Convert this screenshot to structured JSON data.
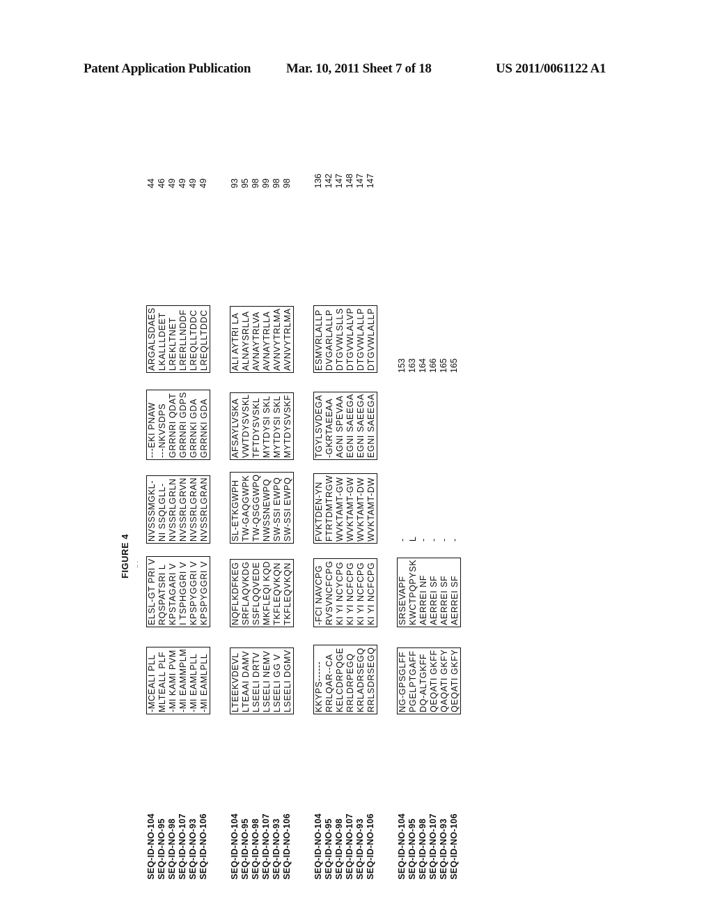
{
  "header": {
    "publication": "Patent Application Publication",
    "date_sheet": "Mar. 10, 2011  Sheet 7 of 18",
    "patent_number": "US 2011/0061122 A1"
  },
  "figure": {
    "title": "FIGURE 4",
    "mark": "..  ."
  },
  "sequence_ids": [
    "SEQ-ID-NO-104",
    "SEQ-ID-NO-95",
    "SEQ-ID-NO-98",
    "SEQ-ID-NO-107",
    "SEQ-ID-NO-93",
    "SEQ-ID-NO-106"
  ],
  "blocks": [
    {
      "segments": [
        [
          "-MCEALI PLL",
          "MLTEALL PLF",
          "-MI KAMI PVM",
          "-MI EAMMPLM",
          "-MI EAMLPLL",
          "-MI EAMLPLL"
        ],
        [
          "ELSL-GT PRI V",
          "RQSPATSRI L",
          "KPSTAGARI V",
          "I TSPHGGRI V",
          "KPSPYGGRI V",
          "KPSPYGGRI V"
        ],
        [
          "NVSSSMGKL-",
          "NI SSQLGLL-",
          "NVSSRLGRLN",
          "NVSSRLGRVN",
          "NVSSRLGRAN",
          "NVSSRLGRAN"
        ],
        [
          "---EKI PNAW",
          "---NKVSDPS",
          "GRRNRI QDAT",
          "GRRNRI GDPS",
          "GRRNKI GDA",
          "GRRNKI GDA"
        ],
        [
          "ARGALSDAES",
          "LKALLLDEET",
          "LREKLTNET",
          "LRERLLNDDF",
          "LREQLLTDDC",
          "LREQLLTDDC"
        ]
      ],
      "end_positions": [
        "44",
        "46",
        "49",
        "49",
        "49",
        "49"
      ]
    },
    {
      "segments": [
        [
          "LTEEKVDEVL",
          "LTEAAI DAMV",
          "LSEELI DRTV",
          "LSEELI NEMV",
          "LSEELI GG V",
          "LSEELI DGMV"
        ],
        [
          "NQFLKDFKEG",
          "SRFLAQVKDG",
          "SSFLQQVEDE",
          "MKFLEQI KQD",
          "TKFLEQVKQN",
          "TKFLEQVKQN"
        ],
        [
          "SL-ETKGWPH",
          "TW-GAQGWPK",
          "TW-QSGGWPQ",
          "NWSSNEWPQ",
          "SW-SSI EWPQ",
          "SW-SSI EWPQ"
        ],
        [
          "AFSAYLVSKA",
          "VWTDYSVSKL",
          "TFTDYSVSKL",
          "MYTDYSI SKL",
          "MYTDYSI SKL",
          "MYTDYSVSKF"
        ],
        [
          "ALI AYTRI LA",
          "ALNAYSRLLA",
          "AVNAYTRLVA",
          "AVNAYTRLLA",
          "AVNVYTRLMA",
          "AVNVYTRLMA"
        ]
      ],
      "end_positions": [
        "93",
        "95",
        "98",
        "99",
        "98",
        "98"
      ]
    },
    {
      "segments": [
        [
          "KKYPS------",
          "RRLQAR--CA",
          "KELCDRPQGE",
          "RRLDRPEGQ",
          "KRLADRSEGQ",
          "RRLSDRSEGQ"
        ],
        [
          "-FCI NAVCPG",
          "RVSVNCFCPG",
          "KI YI NCYCPG",
          "KI YI NCFCPG",
          "KI YI NCFCPG",
          "KI YI NCFCPG"
        ],
        [
          "FVKTDEN-YN",
          "FTRTDMTRGW",
          "WVKTAMT-GW",
          "WVKTAMT-GW",
          "WVKTAMT-DW",
          "WVKTAMT-DW"
        ],
        [
          "TGYLSVDEGA",
          "-GKRTAEEAA",
          "AGNI SPEVAA",
          "EGNI SAEEGA",
          "EGNI SAEEGA",
          "EGNI SAEEGA"
        ],
        [
          "ESMVRLALLP",
          "DVGARLALLP",
          "DTGVWLSLLS",
          "DTGVWLALVP",
          "DTGVWLALLP",
          "DTGVWLALLP"
        ]
      ],
      "end_positions": [
        "136",
        "142",
        "147",
        "148",
        "147",
        "147"
      ]
    },
    {
      "segments": [
        [
          "NG-GPSGLFF",
          "PGELPTGAFF",
          "DQ-ALTGKFF",
          "QEQATI GKFF",
          "QAQATI GKFY",
          "QEQATI GKFY"
        ],
        [
          "SRSEVAPF",
          "KWCTPQPYSK",
          "AERREI NF",
          "AERREI SF",
          "AERREI SF",
          "AERREI SF"
        ],
        [
          "-",
          "L",
          "-",
          "-",
          "-",
          "-"
        ]
      ],
      "end_positions": [
        "153",
        "163",
        "164",
        "166",
        "165",
        "165"
      ]
    }
  ]
}
